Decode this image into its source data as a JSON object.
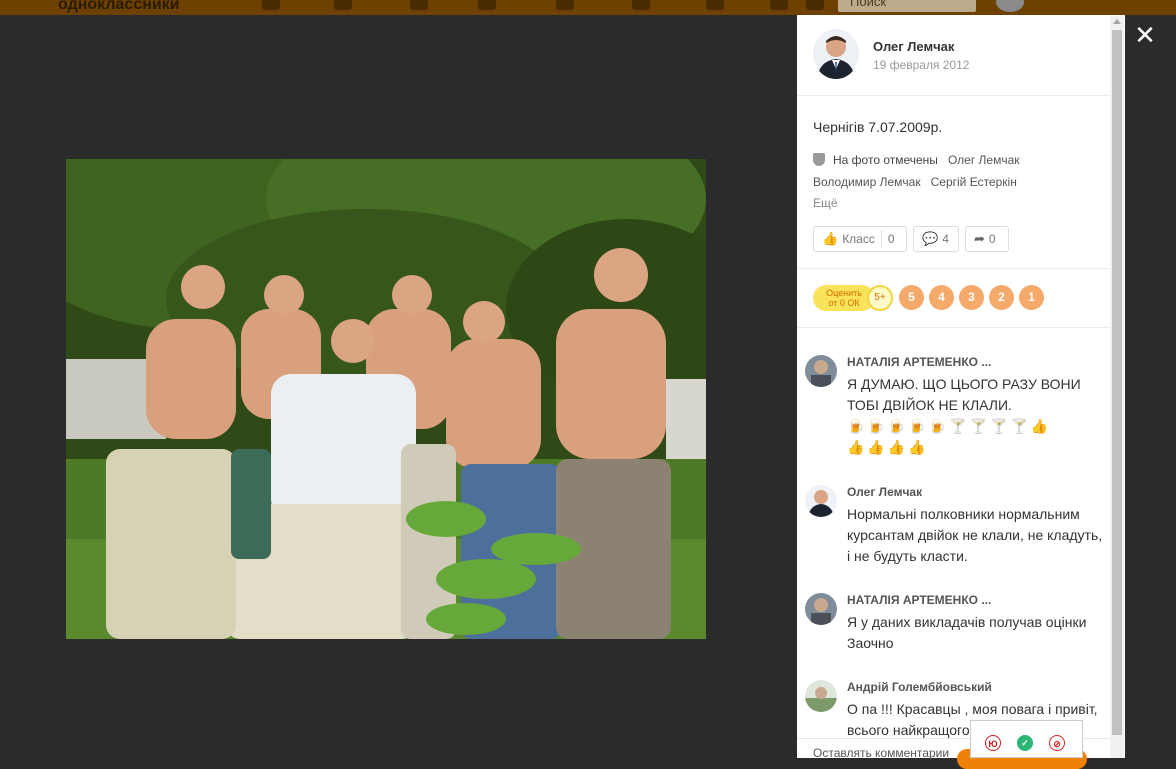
{
  "topbar": {
    "logo": "одноклассники",
    "search_placeholder": "Поиск"
  },
  "panel": {
    "author": {
      "name": "Олег Лемчак",
      "date": "19 февраля 2012"
    },
    "caption": "Чернігів 7.07.2009р.",
    "tagged": {
      "label": "На фото отмечены",
      "people": [
        "Олег Лемчак",
        "Володимир Лемчак",
        "Сергій Естеркін"
      ],
      "more": "Ещё"
    },
    "actions": {
      "like_label": "Класс",
      "like_count": "0",
      "comments_count": "4",
      "share_count": "0"
    },
    "rating": {
      "label_line1": "Оценить",
      "label_line2": "от 0 ОК",
      "plus": "5+",
      "values": [
        "5",
        "4",
        "3",
        "2",
        "1"
      ]
    },
    "comments": [
      {
        "author": "НАТАЛІЯ АРТЕМЕНКО ...",
        "text": "Я ДУМАЮ. ЩО ЦЬОГО РАЗУ ВОНИ ТОБІ ДВІЙОК НЕ КЛАЛИ.",
        "emojis_line1": "🍺🍺🍺🍺🍺🍸🍸🍸🍸👍",
        "emojis_line2": "👍👍👍👍"
      },
      {
        "author": "Олег Лемчак",
        "text": "Нормальні полковники нормальним курсантам двійок не клали, не кладуть, і не будуть класти."
      },
      {
        "author": "НАТАЛІЯ АРТЕМЕНКО ...",
        "text": "Я у даних викладачів получав оцінки  Заочно"
      },
      {
        "author": "Андрій Голембйовський",
        "text": "О па !!! Красавцы , моя повага і привіт, всього найкращого ..."
      }
    ],
    "footer_label": "Оставлять комментарии"
  },
  "ext": {
    "icons": [
      "Ю",
      "✓",
      "⊘"
    ]
  },
  "colors": {
    "topbar": "#6e4100",
    "accent_orange": "#ee8208",
    "rating_circle": "#f5a96a"
  }
}
